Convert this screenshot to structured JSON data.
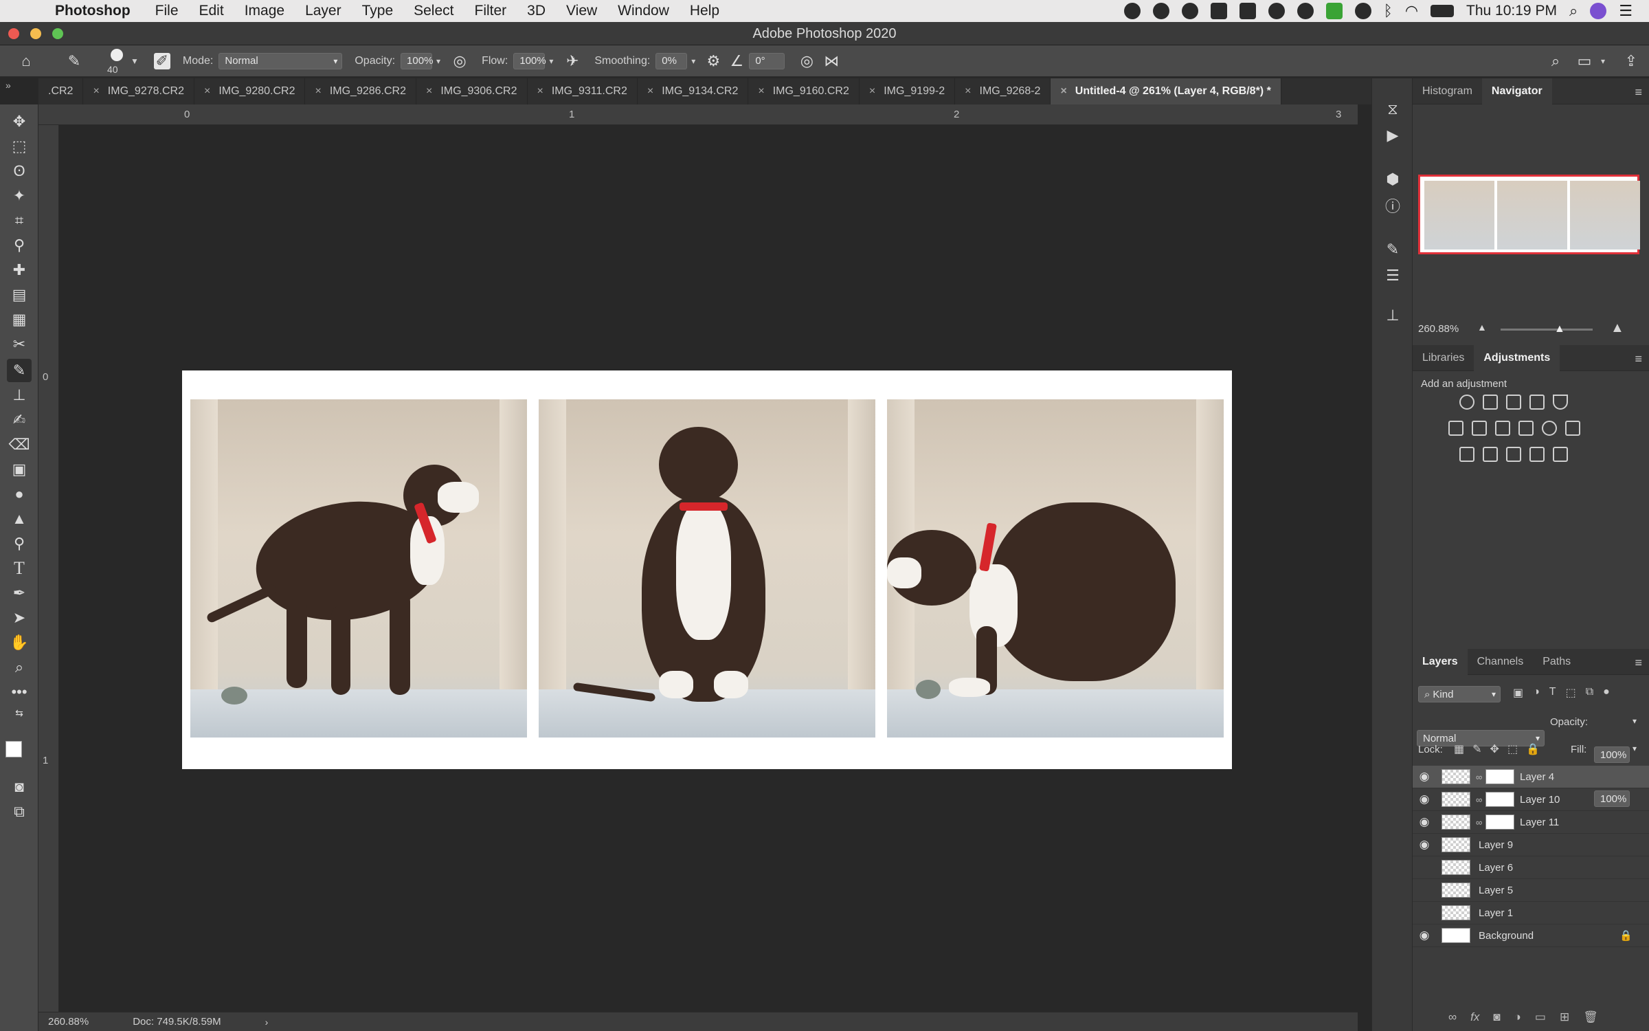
{
  "menubar": {
    "app": "Photoshop",
    "items": [
      "File",
      "Edit",
      "Image",
      "Layer",
      "Type",
      "Select",
      "Filter",
      "3D",
      "View",
      "Window",
      "Help"
    ],
    "clock": "Thu 10:19 PM"
  },
  "window": {
    "title": "Adobe Photoshop 2020"
  },
  "options": {
    "brush_size": "40",
    "mode_label": "Mode:",
    "mode_value": "Normal",
    "opacity_label": "Opacity:",
    "opacity_value": "100%",
    "flow_label": "Flow:",
    "flow_value": "100%",
    "smoothing_label": "Smoothing:",
    "smoothing_value": "0%",
    "angle_value": "0°"
  },
  "tabs": [
    {
      "label": ".CR2"
    },
    {
      "label": "IMG_9278.CR2"
    },
    {
      "label": "IMG_9280.CR2"
    },
    {
      "label": "IMG_9286.CR2"
    },
    {
      "label": "IMG_9306.CR2"
    },
    {
      "label": "IMG_9311.CR2"
    },
    {
      "label": "IMG_9134.CR2"
    },
    {
      "label": "IMG_9160.CR2"
    },
    {
      "label": "IMG_9199-2"
    },
    {
      "label": "IMG_9268-2"
    },
    {
      "label": "Untitled-4 @ 261% (Layer 4, RGB/8*) *"
    }
  ],
  "rulers": {
    "top": [
      "0",
      "1",
      "2",
      "3"
    ],
    "left": [
      "0",
      "1"
    ]
  },
  "status": {
    "zoom": "260.88%",
    "doc": "Doc: 749.5K/8.59M"
  },
  "navigator": {
    "tabs": [
      "Histogram",
      "Navigator"
    ],
    "zoom": "260.88%"
  },
  "adjustments": {
    "tabs": [
      "Libraries",
      "Adjustments"
    ],
    "hint": "Add an adjustment"
  },
  "layers": {
    "tabs": [
      "Layers",
      "Channels",
      "Paths"
    ],
    "filter_kind": "Kind",
    "blend_mode": "Normal",
    "opacity_label": "Opacity:",
    "opacity_value": "100%",
    "lock_label": "Lock:",
    "fill_label": "Fill:",
    "fill_value": "100%",
    "rows": [
      {
        "name": "Layer 4",
        "visible": true,
        "mask": true
      },
      {
        "name": "Layer 10",
        "visible": true,
        "mask": true
      },
      {
        "name": "Layer 11",
        "visible": true,
        "mask": true
      },
      {
        "name": "Layer 9",
        "visible": true,
        "mask": false
      },
      {
        "name": "Layer 6",
        "visible": false,
        "mask": false
      },
      {
        "name": "Layer 5",
        "visible": false,
        "mask": false
      },
      {
        "name": "Layer 1",
        "visible": false,
        "mask": false
      },
      {
        "name": "Background",
        "visible": true,
        "mask": false
      }
    ]
  },
  "colors": {
    "accent_red": "#e0313a",
    "panel_bg": "#3c3c3c",
    "canvas_bg": "#282828"
  }
}
